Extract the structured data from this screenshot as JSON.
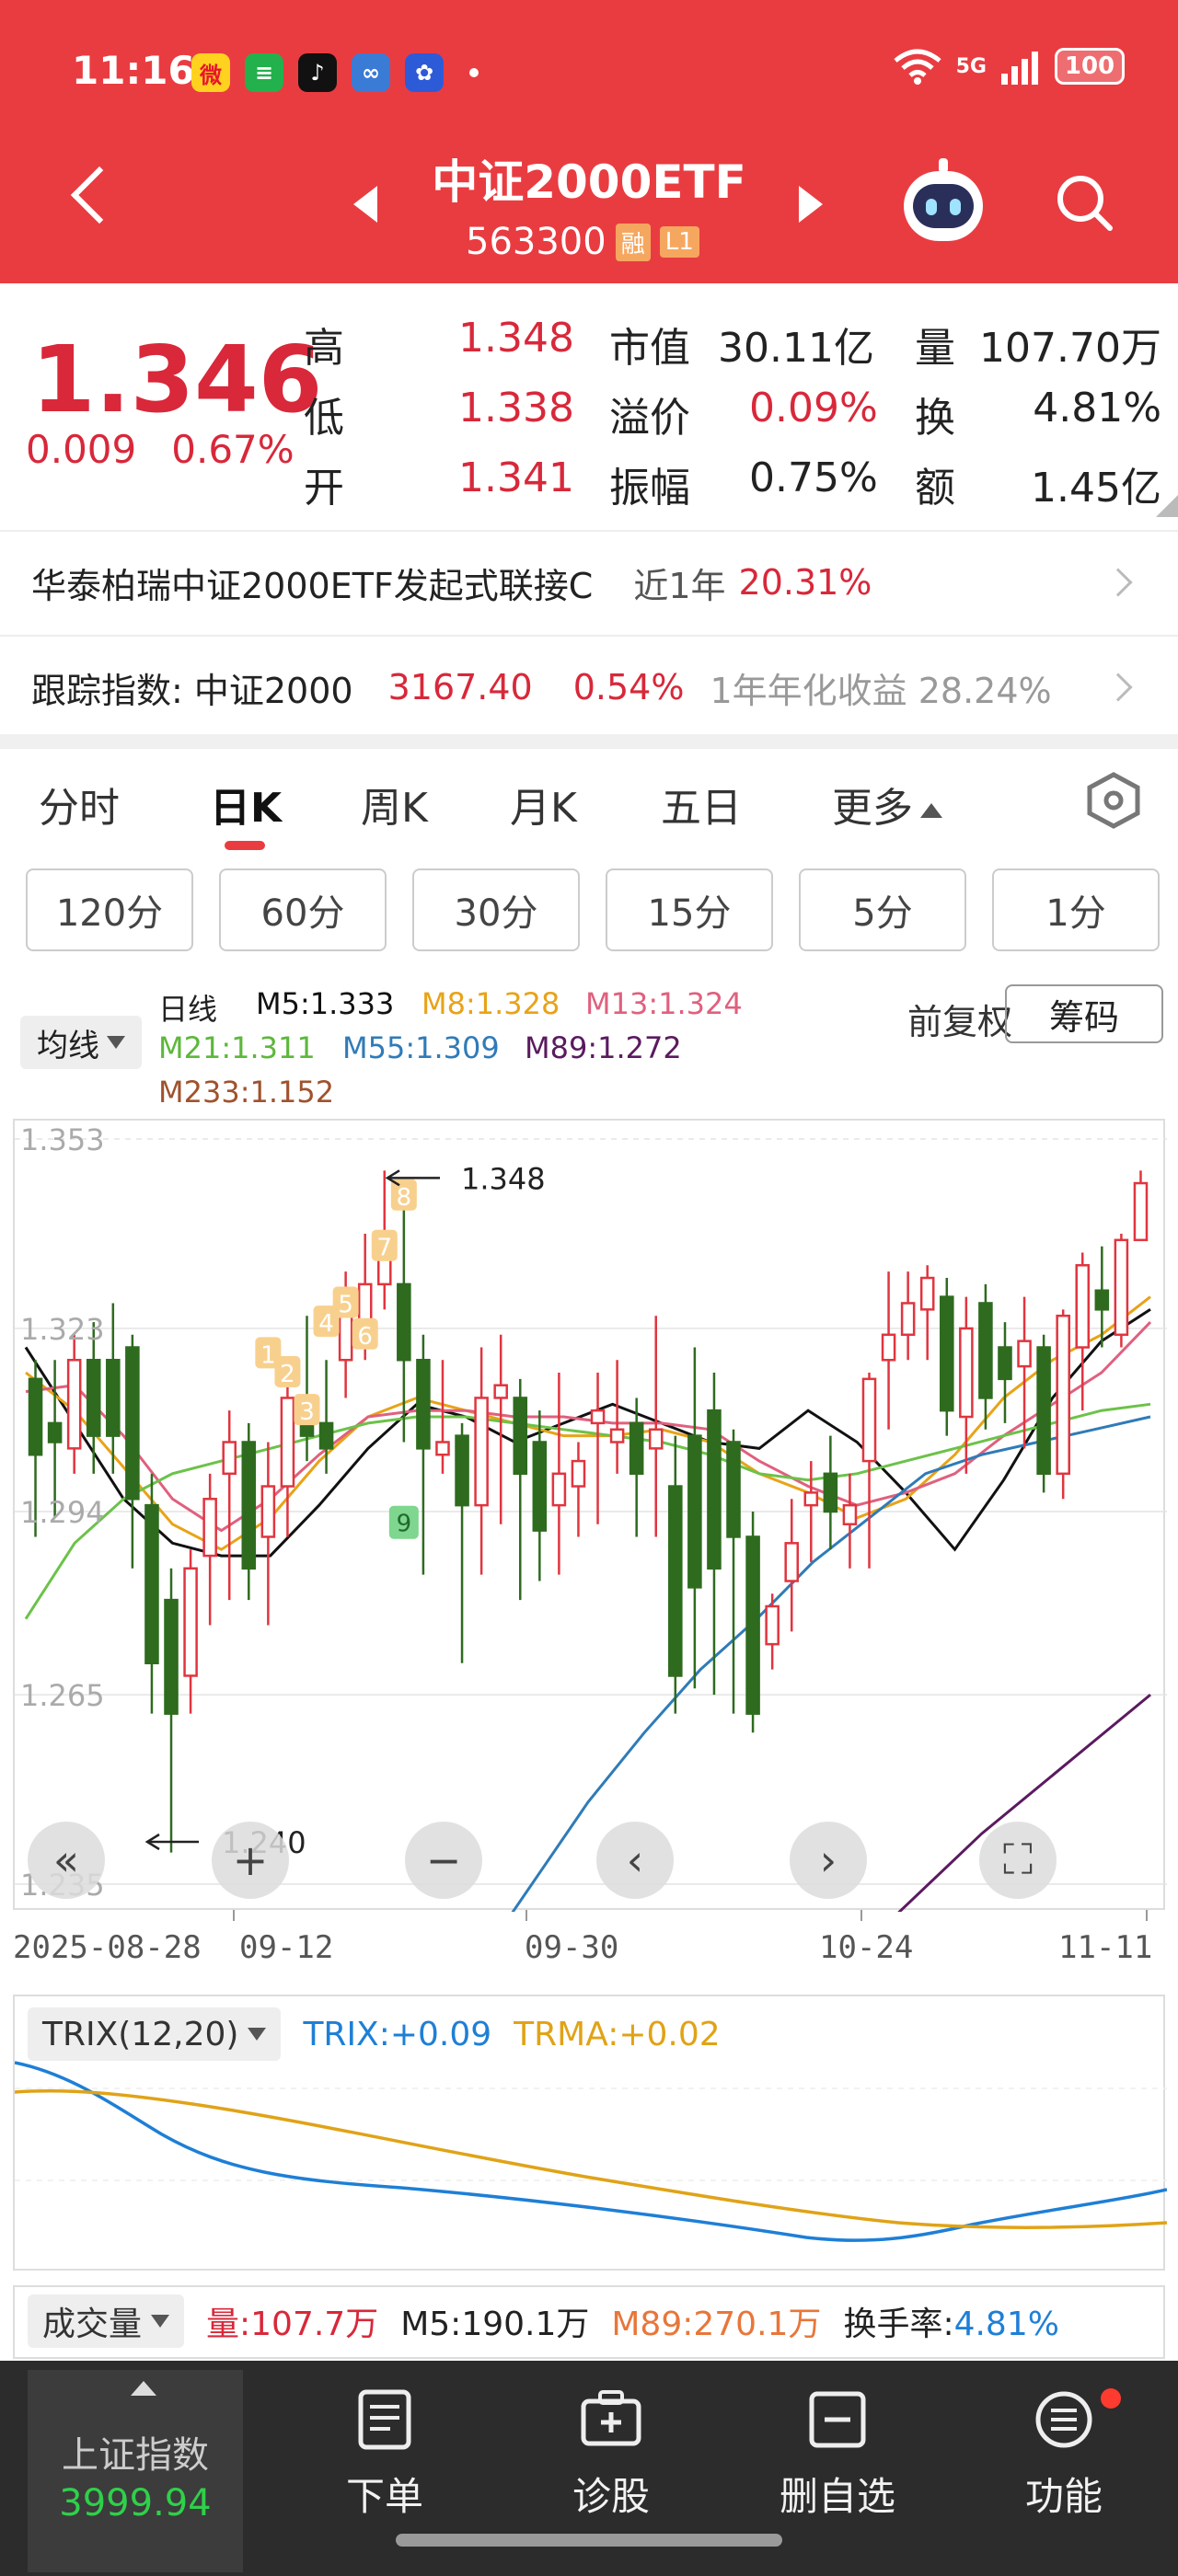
{
  "status": {
    "time": "11:16",
    "network": "5G",
    "battery": "100",
    "app_icons": [
      "weibo-icon",
      "wechat-pay-icon",
      "douyin-icon",
      "app-icon",
      "baidu-icon"
    ]
  },
  "header": {
    "title": "中证2000ETF",
    "code": "563300",
    "tag_margin": "融",
    "tag_level": "L1"
  },
  "quote": {
    "price": "1.346",
    "change": "0.009",
    "change_pct": "0.67%",
    "high_label": "高",
    "high": "1.348",
    "low_label": "低",
    "low": "1.338",
    "open_label": "开",
    "open": "1.341",
    "mktcap_label": "市值",
    "mktcap": "30.11亿",
    "premium_label": "溢价",
    "premium": "0.09%",
    "amplitude_label": "振幅",
    "amplitude": "0.75%",
    "volume_label": "量",
    "volume": "107.70万",
    "turnover_label": "换",
    "turnover": "4.81%",
    "amount_label": "额",
    "amount": "1.45亿"
  },
  "linked_fund": {
    "name": "华泰柏瑞中证2000ETF发起式联接C",
    "period": "近1年",
    "return": "20.31%"
  },
  "tracking": {
    "label": "跟踪指数: 中证2000",
    "index_value": "3167.40",
    "index_pct": "0.54%",
    "annual_label": "1年年化收益 28.24%"
  },
  "tabs": [
    {
      "label": "分时"
    },
    {
      "label": "日K"
    },
    {
      "label": "周K"
    },
    {
      "label": "月K"
    },
    {
      "label": "五日"
    },
    {
      "label": "更多"
    }
  ],
  "intervals": [
    "120分",
    "60分",
    "30分",
    "15分",
    "5分",
    "1分"
  ],
  "legend": {
    "ma_select": "均线",
    "daily": "日线",
    "m5": "M5:1.333",
    "m8": "M8:1.328",
    "m13": "M13:1.324",
    "m21": "M21:1.311",
    "m55": "M55:1.309",
    "m89": "M89:1.272",
    "m233": "M233:1.152",
    "adjust": "前复权",
    "chips": "筹码",
    "colors": {
      "m5": "#111111",
      "m8": "#e8a317",
      "m13": "#e0607e",
      "m21": "#6cc24a",
      "m55": "#2f7bb8",
      "m89": "#5b1a5f",
      "m233": "#a0522d"
    }
  },
  "chart": {
    "y_ticks": [
      "1.353",
      "1.323",
      "1.294",
      "1.265",
      "1.235"
    ],
    "x_labels": [
      "2025-08-28",
      "09-12",
      "09-30",
      "10-24",
      "11-11"
    ],
    "high_mark": "1.348",
    "low_mark": "1.240",
    "seq_numbers": [
      "1",
      "2",
      "3",
      "4",
      "5",
      "6",
      "7",
      "8",
      "9"
    ]
  },
  "chart_data": {
    "type": "candlestick",
    "ylim": [
      1.235,
      1.353
    ],
    "y_ticks": [
      1.353,
      1.323,
      1.294,
      1.265,
      1.235
    ],
    "x_labels": [
      "2025-08-28",
      "09-12",
      "09-30",
      "10-24",
      "11-11"
    ],
    "grid": true,
    "candles": [
      [
        1.315,
        1.303,
        1.318,
        1.29
      ],
      [
        1.308,
        1.305,
        1.318,
        1.293
      ],
      [
        1.304,
        1.318,
        1.322,
        1.3
      ],
      [
        1.318,
        1.306,
        1.324,
        1.3
      ],
      [
        1.318,
        1.306,
        1.327,
        1.3
      ],
      [
        1.32,
        1.296,
        1.322,
        1.285
      ],
      [
        1.295,
        1.27,
        1.3,
        1.262
      ],
      [
        1.28,
        1.262,
        1.285,
        1.24
      ],
      [
        1.268,
        1.285,
        1.288,
        1.262
      ],
      [
        1.287,
        1.296,
        1.3,
        1.276
      ],
      [
        1.3,
        1.305,
        1.31,
        1.28
      ],
      [
        1.305,
        1.285,
        1.308,
        1.28
      ],
      [
        1.29,
        1.298,
        1.305,
        1.276
      ],
      [
        1.298,
        1.312,
        1.316,
        1.29
      ],
      [
        1.312,
        1.306,
        1.325,
        1.302
      ],
      [
        1.308,
        1.304,
        1.318,
        1.3
      ],
      [
        1.318,
        1.326,
        1.332,
        1.312
      ],
      [
        1.323,
        1.33,
        1.338,
        1.318
      ],
      [
        1.33,
        1.338,
        1.348,
        1.326
      ],
      [
        1.33,
        1.318,
        1.342,
        1.305
      ],
      [
        1.318,
        1.304,
        1.322,
        1.284
      ],
      [
        1.303,
        1.305,
        1.318,
        1.3
      ],
      [
        1.306,
        1.295,
        1.308,
        1.27
      ],
      [
        1.295,
        1.312,
        1.32,
        1.284
      ],
      [
        1.312,
        1.314,
        1.322,
        1.292
      ],
      [
        1.312,
        1.3,
        1.315,
        1.28
      ],
      [
        1.305,
        1.291,
        1.31,
        1.283
      ],
      [
        1.295,
        1.3,
        1.316,
        1.284
      ],
      [
        1.298,
        1.302,
        1.305,
        1.29
      ],
      [
        1.308,
        1.31,
        1.316,
        1.292
      ],
      [
        1.305,
        1.307,
        1.318,
        1.3
      ],
      [
        1.308,
        1.3,
        1.312,
        1.29
      ],
      [
        1.304,
        1.307,
        1.325,
        1.29
      ],
      [
        1.298,
        1.268,
        1.306,
        1.262
      ],
      [
        1.306,
        1.282,
        1.32,
        1.266
      ],
      [
        1.31,
        1.285,
        1.316,
        1.265
      ],
      [
        1.305,
        1.29,
        1.307,
        1.262
      ],
      [
        1.29,
        1.262,
        1.294,
        1.259
      ],
      [
        1.273,
        1.279,
        1.281,
        1.269
      ],
      [
        1.283,
        1.289,
        1.296,
        1.275
      ],
      [
        1.295,
        1.297,
        1.302,
        1.286
      ],
      [
        1.3,
        1.294,
        1.306,
        1.288
      ],
      [
        1.292,
        1.295,
        1.3,
        1.285
      ],
      [
        1.302,
        1.315,
        1.316,
        1.285
      ],
      [
        1.318,
        1.322,
        1.332,
        1.307
      ],
      [
        1.322,
        1.327,
        1.332,
        1.318
      ],
      [
        1.326,
        1.331,
        1.333,
        1.318
      ],
      [
        1.328,
        1.31,
        1.331,
        1.306
      ],
      [
        1.309,
        1.323,
        1.328,
        1.3
      ],
      [
        1.327,
        1.312,
        1.33,
        1.307
      ],
      [
        1.32,
        1.315,
        1.324,
        1.308
      ],
      [
        1.317,
        1.321,
        1.328,
        1.304
      ],
      [
        1.32,
        1.3,
        1.322,
        1.297
      ],
      [
        1.3,
        1.325,
        1.326,
        1.296
      ],
      [
        1.32,
        1.333,
        1.335,
        1.31
      ],
      [
        1.329,
        1.326,
        1.336,
        1.32
      ],
      [
        1.322,
        1.337,
        1.338,
        1.32
      ],
      [
        1.337,
        1.346,
        1.348,
        1.338
      ]
    ],
    "ma_lines": {
      "M5": [
        1.32,
        1.308,
        1.296,
        1.289,
        1.287,
        1.287,
        1.295,
        1.304,
        1.311,
        1.309,
        1.305,
        1.308,
        1.311,
        1.308,
        1.305,
        1.304,
        1.31,
        1.305,
        1.297,
        1.288,
        1.299,
        1.312,
        1.321,
        1.326
      ],
      "M8": [
        1.316,
        1.31,
        1.301,
        1.292,
        1.288,
        1.293,
        1.302,
        1.309,
        1.312,
        1.31,
        1.308,
        1.306,
        1.306,
        1.307,
        1.305,
        1.3,
        1.297,
        1.293,
        1.296,
        1.303,
        1.312,
        1.318,
        1.322,
        1.328
      ],
      "M13": [
        1.313,
        1.314,
        1.306,
        1.296,
        1.291,
        1.296,
        1.303,
        1.309,
        1.31,
        1.31,
        1.309,
        1.309,
        1.308,
        1.308,
        1.307,
        1.302,
        1.298,
        1.295,
        1.297,
        1.3,
        1.306,
        1.311,
        1.316,
        1.324
      ],
      "M21": [
        1.277,
        1.289,
        1.296,
        1.3,
        1.302,
        1.304,
        1.306,
        1.308,
        1.309,
        1.309,
        1.308,
        1.307,
        1.306,
        1.305,
        1.303,
        1.3,
        1.299,
        1.3,
        1.302,
        1.304,
        1.306,
        1.308,
        1.31,
        1.311
      ],
      "M55": [
        1.199,
        1.212,
        1.222,
        1.235,
        1.248,
        1.259,
        1.269,
        1.277,
        1.286,
        1.293,
        1.3,
        1.303,
        1.305,
        1.307,
        1.309
      ]
    }
  },
  "controls": [
    "rewind-icon",
    "zoom-in-icon",
    "zoom-out-icon",
    "prev-icon",
    "next-icon",
    "fullscreen-icon"
  ],
  "trix": {
    "select": "TRIX(12,20)",
    "trix": "TRIX:+0.09",
    "trma": "TRMA:+0.02"
  },
  "volume": {
    "select": "成交量",
    "vol": "量:107.7万",
    "m5": "M5:190.1万",
    "m89": "M89:270.1万",
    "turnover_label": "换手率:",
    "turnover_value": "4.81%"
  },
  "bottom": {
    "index_name": "上证指数",
    "index_value": "3999.94",
    "order": "下单",
    "diagnose": "诊股",
    "remove_fav": "删自选",
    "functions": "功能"
  }
}
